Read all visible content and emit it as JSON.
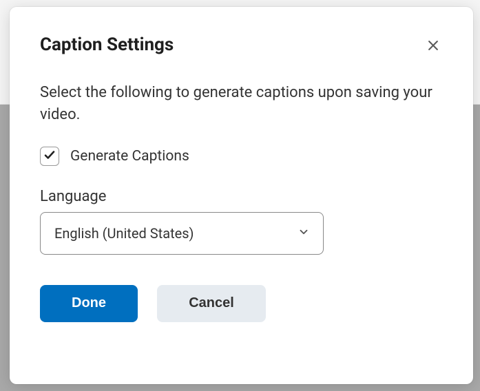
{
  "modal": {
    "title": "Caption Settings",
    "description": "Select the following to generate captions upon saving your video.",
    "checkbox": {
      "label": "Generate Captions",
      "checked": true
    },
    "language": {
      "label": "Language",
      "selected": "English (United States)"
    },
    "actions": {
      "done": "Done",
      "cancel": "Cancel"
    }
  }
}
